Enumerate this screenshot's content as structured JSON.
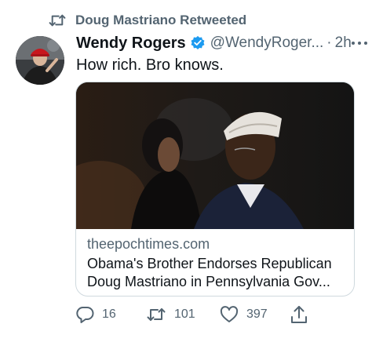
{
  "retweet": {
    "label": "Doug Mastriano Retweeted",
    "icon": "retweet-icon"
  },
  "tweet": {
    "author_name": "Wendy Rogers",
    "author_handle": "@WendyRoger...",
    "separator": "·",
    "time": "2h",
    "text": "How rich. Bro knows.",
    "verified_color": "#1d9bf0"
  },
  "card": {
    "domain": "theepochtimes.com",
    "title_line1": "Obama's Brother Endorses Republican",
    "title_line2": "Doug Mastriano in Pennsylvania Gov..."
  },
  "actions": {
    "replies": "16",
    "retweets": "101",
    "likes": "397"
  },
  "colors": {
    "secondary_text": "#536471",
    "primary_text": "#0f1419",
    "border": "#cfd9de"
  }
}
